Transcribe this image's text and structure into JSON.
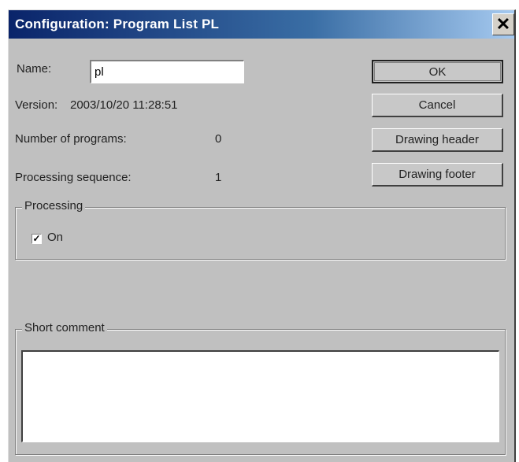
{
  "window": {
    "title": "Configuration: Program List PL",
    "close_glyph": "✕"
  },
  "form": {
    "name_label": "Name:",
    "name_value": "pl",
    "version_label": "Version:",
    "version_value": "2003/10/20 11:28:51",
    "programs_label": "Number of programs:",
    "programs_value": "0",
    "sequence_label": "Processing sequence:",
    "sequence_value": "1"
  },
  "buttons": {
    "ok": "OK",
    "cancel": "Cancel",
    "drawing_header": "Drawing header",
    "drawing_footer": "Drawing footer"
  },
  "processing": {
    "group_label": "Processing",
    "on_label": "On",
    "on_checked": true,
    "check_glyph": "✓"
  },
  "comment": {
    "group_label": "Short comment",
    "value": ""
  },
  "colors": {
    "title_gradient_start": "#0a246a",
    "title_gradient_end": "#a6caf0",
    "dialog_face": "#c0c0c0"
  }
}
